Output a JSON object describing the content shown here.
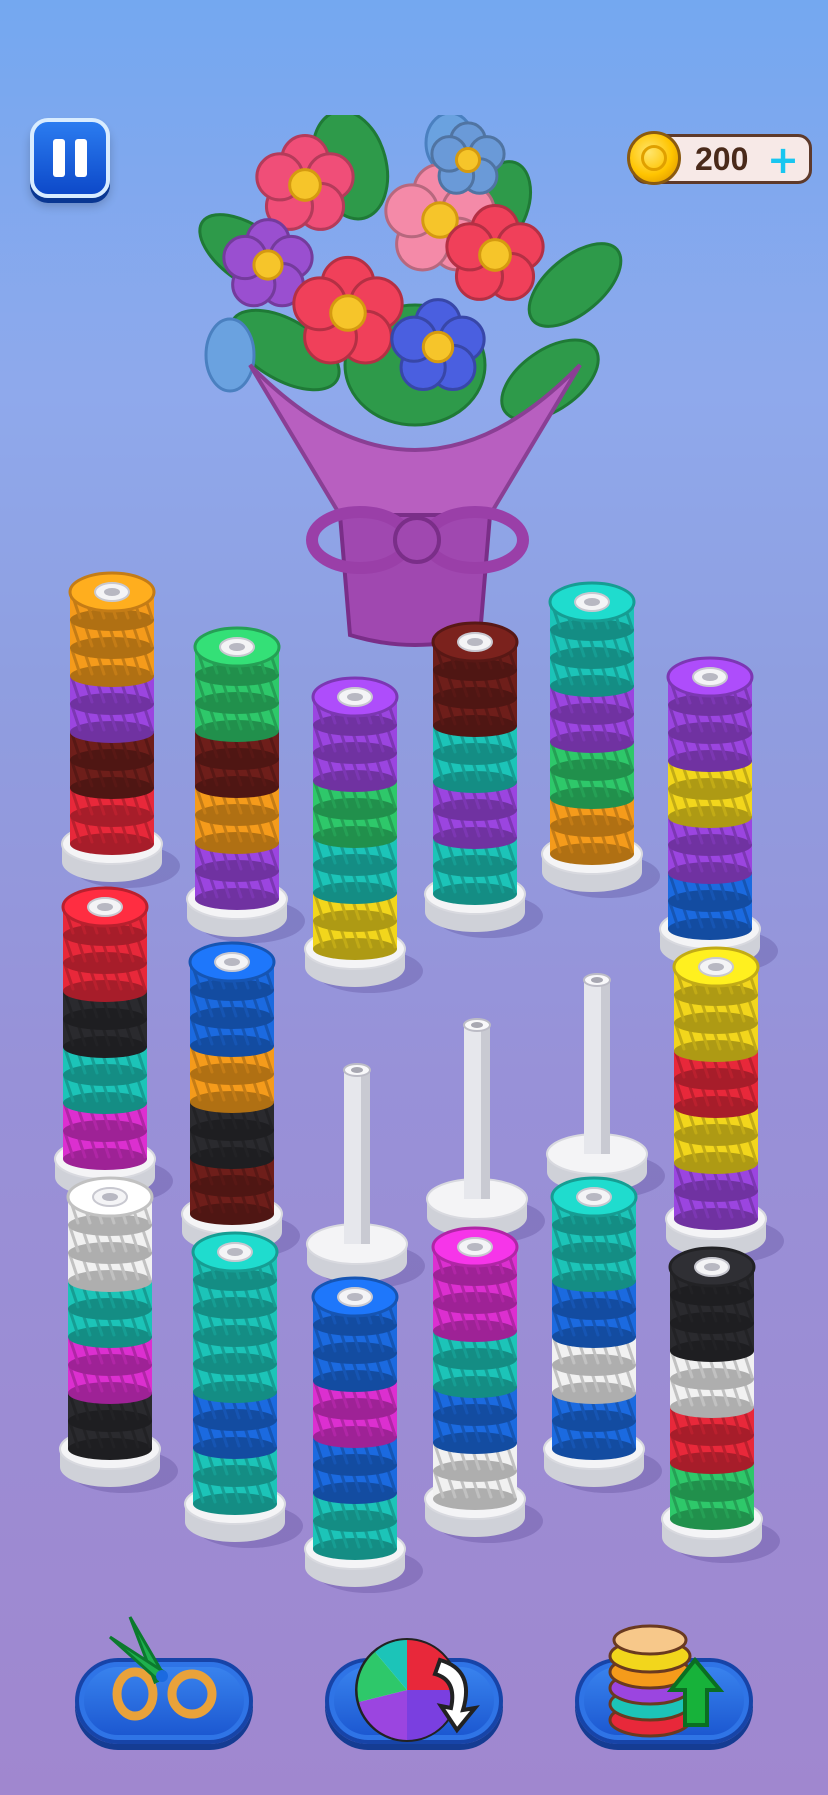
{
  "hud": {
    "pause_icon": "pause-icon",
    "coins": "200",
    "coin_icon": "gold-coin-icon",
    "add_icon": "+"
  },
  "goal": {
    "image": "crocheted-flower-bouquet",
    "flowers": [
      "#f04e78",
      "#f48aa8",
      "#f0405a",
      "#9a4fd0",
      "#4a5fe0",
      "#6a9ad8"
    ]
  },
  "colors": {
    "orange": "#f59b1b",
    "purple": "#9b45e0",
    "maroon": "#6e1e1a",
    "red": "#e8283a",
    "green": "#2ec86a",
    "teal": "#1cc4b8",
    "yellow": "#f2d61c",
    "blue": "#1b6ae0",
    "black": "#2a2a2e",
    "magenta": "#dc2fd0",
    "white": "#f1f1f1"
  },
  "pegs": [
    {
      "rings": [
        "red",
        "red",
        "maroon",
        "maroon",
        "purple",
        "purple",
        "orange",
        "orange",
        "orange"
      ]
    },
    {
      "rings": [
        "purple",
        "purple",
        "orange",
        "orange",
        "maroon",
        "maroon",
        "green",
        "green",
        "green"
      ]
    },
    {
      "rings": [
        "yellow",
        "yellow",
        "teal",
        "teal",
        "green",
        "green",
        "purple",
        "purple",
        "purple"
      ]
    },
    {
      "rings": [
        "teal",
        "teal",
        "purple",
        "purple",
        "teal",
        "teal",
        "maroon",
        "maroon",
        "maroon"
      ]
    },
    {
      "rings": [
        "orange",
        "orange",
        "green",
        "green",
        "purple",
        "purple",
        "teal",
        "teal",
        "teal"
      ]
    },
    {
      "rings": [
        "blue",
        "blue",
        "purple",
        "purple",
        "yellow",
        "yellow",
        "purple",
        "purple",
        "purple"
      ]
    },
    {
      "rings": [
        "magenta",
        "magenta",
        "teal",
        "teal",
        "black",
        "black",
        "red",
        "red",
        "red"
      ]
    },
    {
      "rings": [
        "maroon",
        "maroon",
        "black",
        "black",
        "orange",
        "orange",
        "blue",
        "blue",
        "blue"
      ]
    },
    {
      "rings": []
    },
    {
      "rings": []
    },
    {
      "rings": []
    },
    {
      "rings": [
        "purple",
        "purple",
        "yellow",
        "yellow",
        "red",
        "red",
        "yellow",
        "yellow",
        "yellow"
      ]
    },
    {
      "rings": [
        "black",
        "black",
        "magenta",
        "magenta",
        "teal",
        "teal",
        "white",
        "white",
        "white"
      ]
    },
    {
      "rings": [
        "teal",
        "teal",
        "blue",
        "blue",
        "teal",
        "teal",
        "teal",
        "teal",
        "teal"
      ]
    },
    {
      "rings": [
        "teal",
        "teal",
        "blue",
        "blue",
        "magenta",
        "magenta",
        "blue",
        "blue",
        "blue"
      ]
    },
    {
      "rings": [
        "white",
        "white",
        "blue",
        "blue",
        "teal",
        "teal",
        "magenta",
        "magenta",
        "magenta"
      ]
    },
    {
      "rings": [
        "blue",
        "blue",
        "white",
        "white",
        "blue",
        "blue",
        "teal",
        "teal",
        "teal"
      ]
    },
    {
      "rings": [
        "green",
        "green",
        "red",
        "red",
        "white",
        "white",
        "black",
        "black",
        "black"
      ]
    }
  ],
  "boosters": [
    {
      "name": "scissors",
      "icon": "scissors-icon"
    },
    {
      "name": "shuffle",
      "icon": "yarn-shuffle-icon"
    },
    {
      "name": "add-ring",
      "icon": "ring-stack-up-icon"
    }
  ]
}
